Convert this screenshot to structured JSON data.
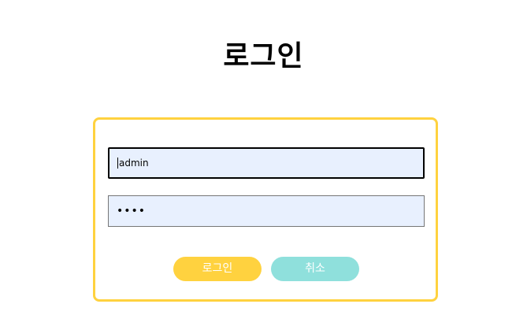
{
  "page": {
    "title": "로그인"
  },
  "form": {
    "username_value": "admin",
    "password_masked": "••••",
    "login_label": "로그인",
    "cancel_label": "취소"
  },
  "colors": {
    "accent": "#FFD23F",
    "cancel": "#8FE0DC",
    "input_bg": "#E8F0FE"
  }
}
